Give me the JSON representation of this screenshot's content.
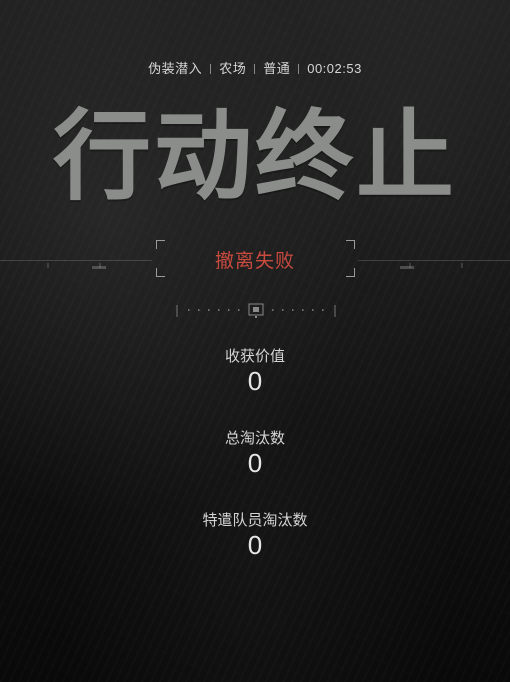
{
  "header": {
    "mode": "伪装潜入",
    "map": "农场",
    "difficulty": "普通",
    "time": "00:02:53"
  },
  "title": "行动终止",
  "status": {
    "text": "撤离失败",
    "color": "#c94a3e"
  },
  "stats": [
    {
      "label": "收获价值",
      "value": "0"
    },
    {
      "label": "总淘汰数",
      "value": "0"
    },
    {
      "label": "特遣队员淘汰数",
      "value": "0"
    }
  ]
}
